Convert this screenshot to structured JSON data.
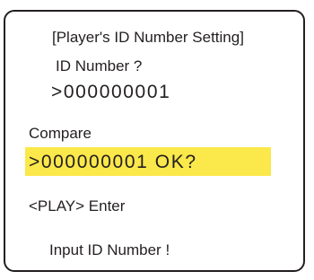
{
  "screen": {
    "title": "[Player's ID Number Setting]",
    "prompt": "ID Number  ?",
    "entered_value": ">000000001",
    "compare_label": "Compare",
    "confirm_value": ">000000001 OK?",
    "enter_hint": "<PLAY>   Enter",
    "footer_message": "Input ID Number !",
    "highlight_color": "#fbe84a"
  }
}
